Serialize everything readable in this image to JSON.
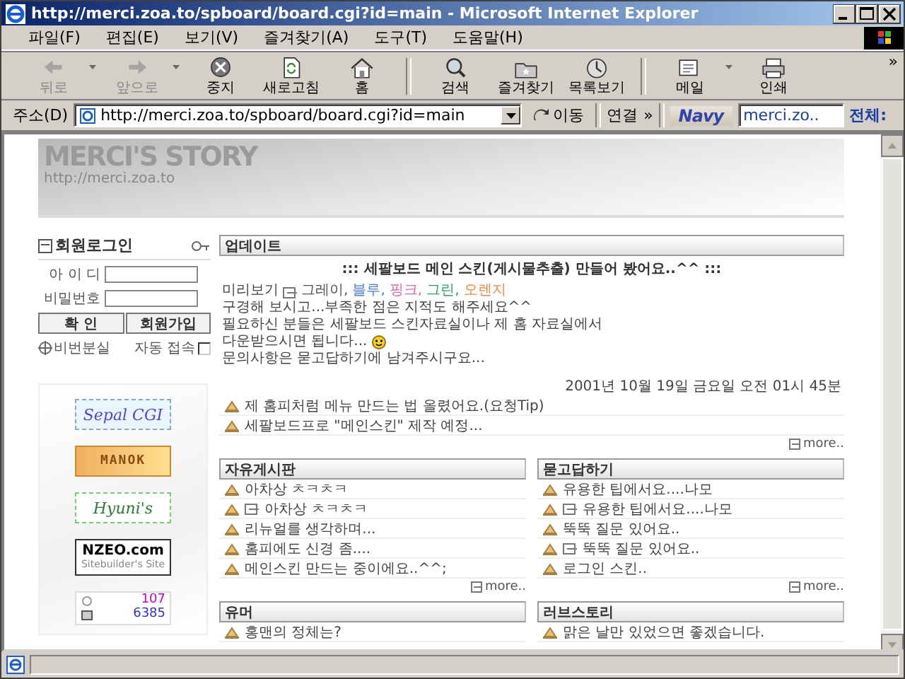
{
  "window": {
    "title": "http://merci.zoa.to/spboard/board.cgi?id=main - Microsoft Internet Explorer"
  },
  "menu": [
    "파일(F)",
    "편집(E)",
    "보기(V)",
    "즐겨찾기(A)",
    "도구(T)",
    "도움말(H)"
  ],
  "toolbar": {
    "groups": [
      [
        {
          "label": "뒤로",
          "disabled": true,
          "dropdown": true
        },
        {
          "label": "앞으로",
          "disabled": true,
          "dropdown": true
        },
        {
          "label": "중지",
          "disabled": false,
          "dropdown": false
        },
        {
          "label": "새로고침",
          "disabled": false,
          "dropdown": false
        },
        {
          "label": "홈",
          "disabled": false,
          "dropdown": false
        }
      ],
      [
        {
          "label": "검색",
          "disabled": false,
          "dropdown": false
        },
        {
          "label": "즐겨찾기",
          "disabled": false,
          "dropdown": false
        },
        {
          "label": "목록보기",
          "disabled": false,
          "dropdown": false
        }
      ],
      [
        {
          "label": "메일",
          "disabled": false,
          "dropdown": true
        },
        {
          "label": "인쇄",
          "disabled": false,
          "dropdown": false
        }
      ]
    ],
    "overflow": "»"
  },
  "address": {
    "label": "주소(D)",
    "url": "http://merci.zoa.to/spboard/board.cgi?id=main",
    "go": "이동",
    "links": "연결",
    "links_more": "»",
    "logo": "Navy",
    "search_value": "merci.zo..",
    "search_scope": "전체:"
  },
  "site": {
    "title": "MERCI'S STORY",
    "url": "http://merci.zoa.to"
  },
  "login": {
    "title": "회원로그인",
    "fields": [
      {
        "label": "아 이 디"
      },
      {
        "label": "비밀번호"
      }
    ],
    "buttons": [
      "확 인",
      "회원가입"
    ],
    "lost_password": "비번분실",
    "auto_login": {
      "label": "자동 접속",
      "checked": false
    }
  },
  "banners": [
    {
      "kind": "sepal",
      "text": "Sepal CGI"
    },
    {
      "kind": "manok",
      "text": "MANOK"
    },
    {
      "kind": "hyuni",
      "text": "Hyuni's"
    },
    {
      "kind": "nzeo",
      "text": "NZEO.com",
      "subtext": "Sitebuilder's Site"
    },
    {
      "kind": "counter",
      "today": "107",
      "total": "6385"
    }
  ],
  "update": {
    "title": "업데이트",
    "headline": "::: 세팔보드 메인 스킨(게시물추출) 만들어 봤어요..^^ :::",
    "preview_label": "미리보기",
    "skins": [
      {
        "name": "그레이,",
        "color": "#555555"
      },
      {
        "name": "블루,",
        "color": "#4a7fd6"
      },
      {
        "name": "핑크,",
        "color": "#e06aa8"
      },
      {
        "name": "그린,",
        "color": "#2f9e6a"
      },
      {
        "name": "오렌지",
        "color": "#ee8844"
      }
    ],
    "lines": [
      "구경해 보시고...부족한 점은 지적도 해주세요^^",
      "필요하신 분들은 세팔보드 스킨자료실이나 제 홈 자료실에서",
      "다운받으시면 됩니다...",
      "문의사항은 묻고답하기에 남겨주시구요..."
    ],
    "date": "2001년 10월 19일 금요일 오전 01시 45분",
    "posts": [
      "제 홈피처럼 메뉴 만드는 법 올렸어요.(요청Tip)",
      "세팔보드프로 \"메인스킨\" 제작 예정..."
    ],
    "more": "more.."
  },
  "boards": [
    {
      "title": "자유게시판",
      "items": [
        {
          "text": "아차상 ㅊㅋㅊㅋ",
          "reply": false
        },
        {
          "text": "아차상 ㅊㅋㅊㅋ",
          "reply": true
        },
        {
          "text": "리뉴얼를 생각하며...",
          "reply": false
        },
        {
          "text": "홈피에도 신경 좀....",
          "reply": false
        },
        {
          "text": "메인스킨 만드는 중이에요..^^;",
          "reply": false
        }
      ],
      "more": "more.."
    },
    {
      "title": "묻고답하기",
      "items": [
        {
          "text": "유용한 팁에서요....나모",
          "reply": false
        },
        {
          "text": "유용한 팁에서요....나모",
          "reply": true
        },
        {
          "text": "뚝뚝 질문 있어요..",
          "reply": false
        },
        {
          "text": "뚝뚝 질문 있어요..",
          "reply": true
        },
        {
          "text": "로그인 스킨..",
          "reply": false
        }
      ],
      "more": "more.."
    },
    {
      "title": "유머",
      "items": [
        {
          "text": "홍맨의 정체는?",
          "reply": false
        }
      ]
    },
    {
      "title": "러브스토리",
      "items": [
        {
          "text": "맑은 날만 있었으면 좋겠습니다.",
          "reply": false
        }
      ]
    }
  ]
}
